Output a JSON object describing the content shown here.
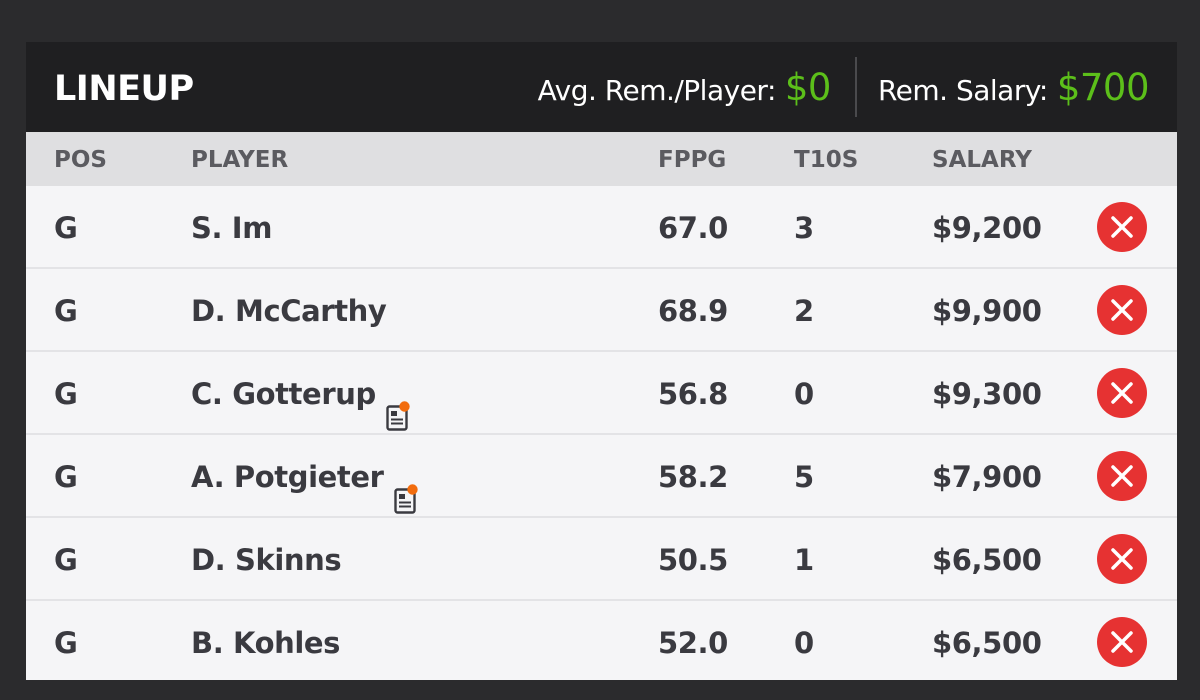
{
  "header": {
    "title": "LINEUP",
    "avg_label": "Avg. Rem./Player:",
    "avg_value": "$0",
    "rem_label": "Rem. Salary:",
    "rem_value": "$700"
  },
  "columns": {
    "pos": "POS",
    "player": "PLAYER",
    "fppg": "FPPG",
    "t10s": "T10S",
    "salary": "SALARY"
  },
  "rows": [
    {
      "pos": "G",
      "player": "S. Im",
      "fppg": "67.0",
      "t10s": "3",
      "salary": "$9,200",
      "news": false
    },
    {
      "pos": "G",
      "player": "D. McCarthy",
      "fppg": "68.9",
      "t10s": "2",
      "salary": "$9,900",
      "news": false
    },
    {
      "pos": "G",
      "player": "C. Gotterup",
      "fppg": "56.8",
      "t10s": "0",
      "salary": "$9,300",
      "news": true
    },
    {
      "pos": "G",
      "player": "A. Potgieter",
      "fppg": "58.2",
      "t10s": "5",
      "salary": "$7,900",
      "news": true
    },
    {
      "pos": "G",
      "player": "D. Skinns",
      "fppg": "50.5",
      "t10s": "1",
      "salary": "$6,500",
      "news": false
    },
    {
      "pos": "G",
      "player": "B. Kohles",
      "fppg": "52.0",
      "t10s": "0",
      "salary": "$6,500",
      "news": false
    }
  ],
  "icons": {
    "remove": "close-circle-icon",
    "news": "player-news-icon"
  },
  "colors": {
    "accent_green": "#5cbf1a",
    "remove_red": "#e63232",
    "news_dot": "#f26c0d"
  }
}
